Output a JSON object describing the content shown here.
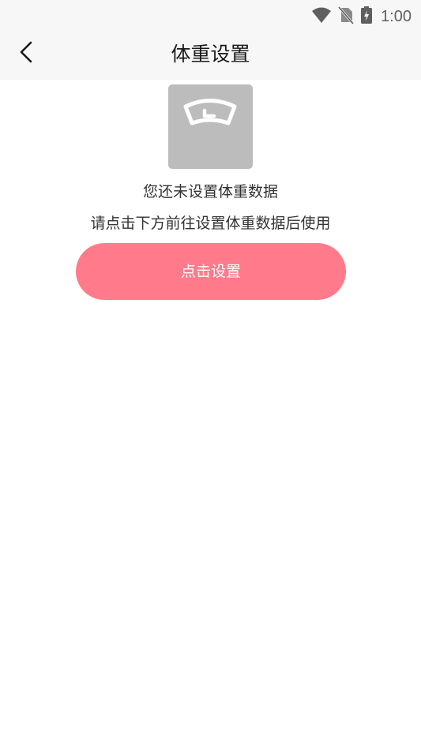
{
  "status_bar": {
    "time": "1:00",
    "icons": [
      "wifi-icon",
      "no-sim-icon",
      "battery-charging-icon"
    ]
  },
  "header": {
    "title": "体重设置",
    "back_icon": "chevron-left-icon"
  },
  "empty_state": {
    "image_icon": "weighing-scale-icon",
    "message": "您还未设置体重数据",
    "hint": "请点击下方前往设置体重数据后使用"
  },
  "action": {
    "button_label": "点击设置"
  },
  "colors": {
    "accent": "#ff7b8b",
    "header_bg": "#f7f7f7",
    "placeholder_bg": "#bcbcbc"
  }
}
